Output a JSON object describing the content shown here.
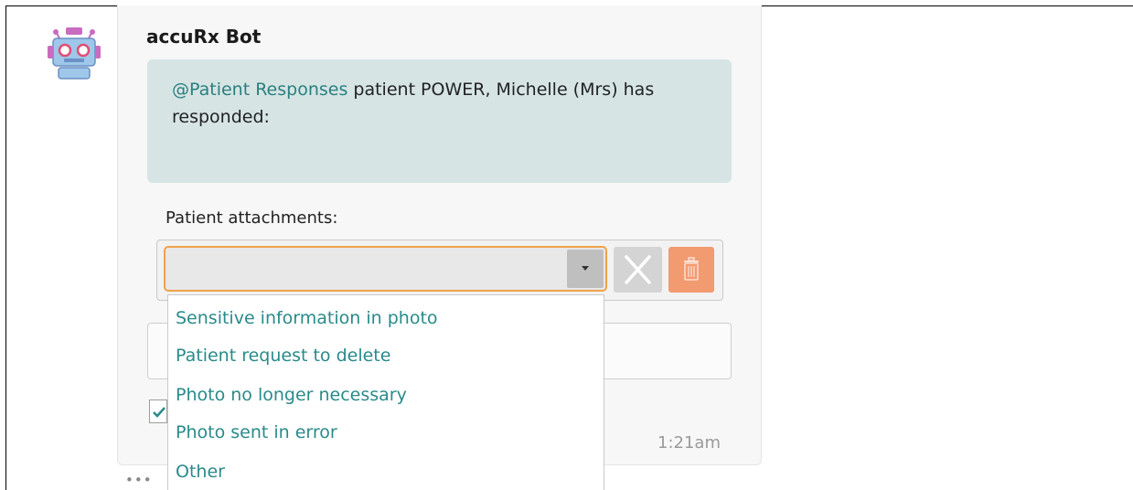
{
  "message": {
    "sender": "accuRx Bot",
    "mention": "@Patient Responses",
    "body": " patient POWER, Michelle (Mrs) has responded:",
    "timestamp": "1:21am"
  },
  "attachments": {
    "label": "Patient attachments:",
    "selected_value": "",
    "options": [
      "Sensitive information in photo",
      "Patient request to delete",
      "Photo no longer necessary",
      "Photo sent in error",
      "Other"
    ]
  },
  "icons": {
    "avatar": "robot-icon",
    "dropdown": "chevron-down-icon",
    "cancel": "close-icon",
    "delete": "trash-icon",
    "check": "check-icon",
    "more": "more-dots-icon"
  },
  "colors": {
    "accent_teal": "#2a8a8a",
    "bubble_bg": "#d6e4e4",
    "select_focus": "#f0a24a",
    "delete_button": "#f29a70"
  },
  "more_indicator": "•••"
}
